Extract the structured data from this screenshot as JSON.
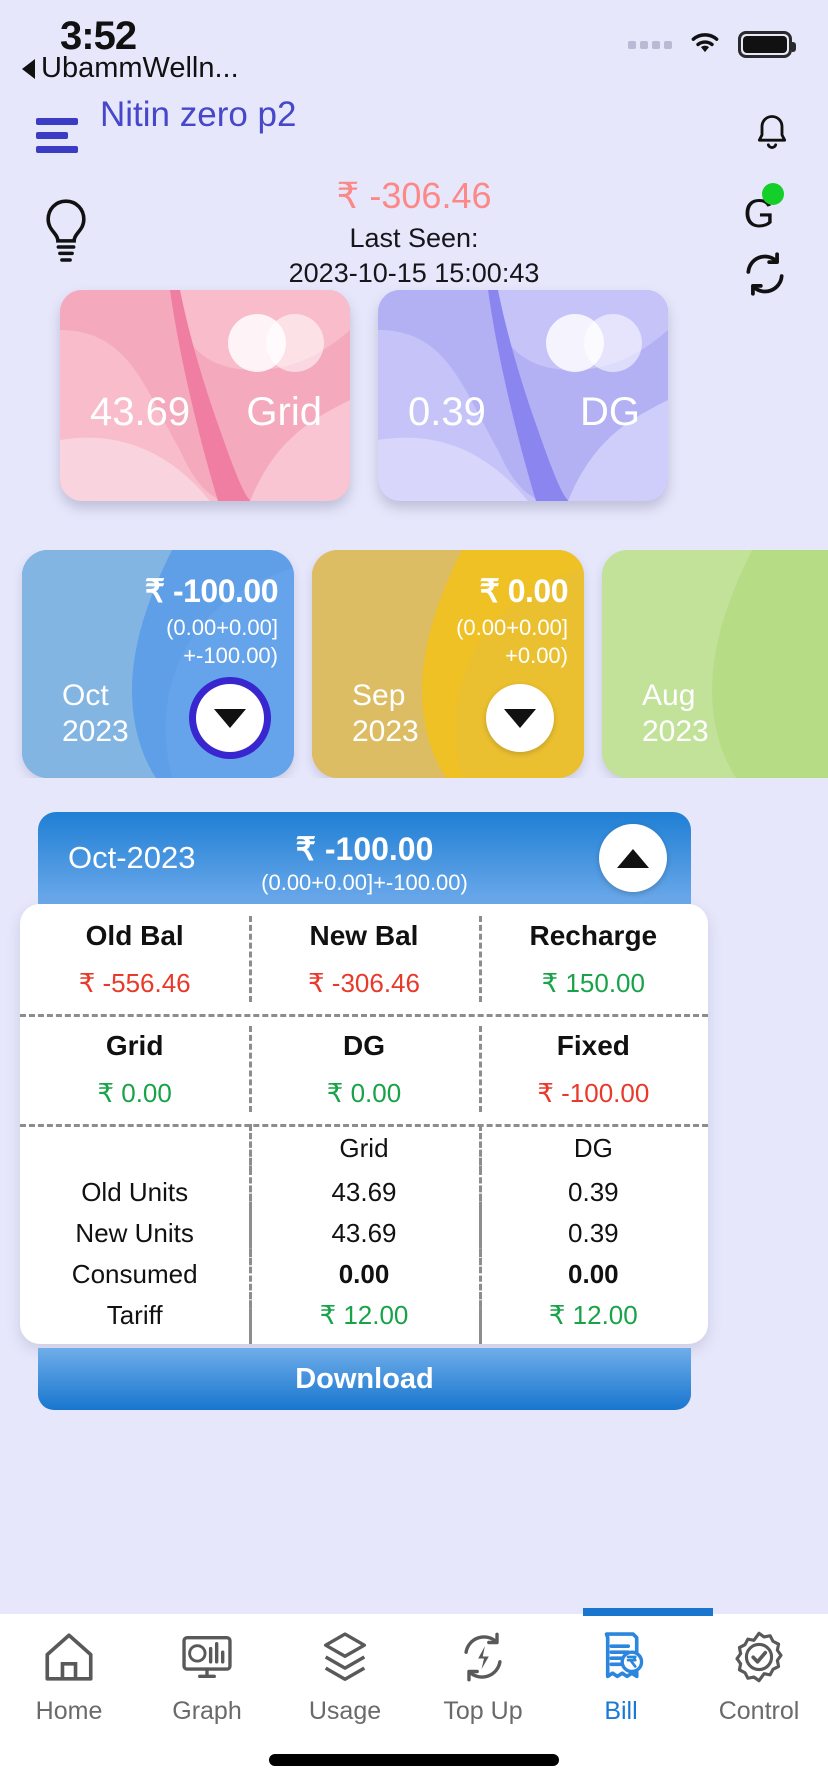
{
  "status_bar": {
    "time": "3:52",
    "back_label": "UbammWelln...",
    "wifi_icon": "wifi-icon",
    "battery_icon": "battery-icon",
    "signal_icon": "signal-dots-icon"
  },
  "header": {
    "menu_icon": "hamburger-icon",
    "title": "Nitin zero p2",
    "bell_icon": "bell-icon"
  },
  "balance": {
    "bulb_icon": "bulb-icon",
    "amount": "₹ -306.46",
    "amount_color": "#fd8888",
    "last_seen_label": "Last Seen:",
    "last_seen_value": "2023-10-15 15:00:43",
    "gateway_letter": "G",
    "gateway_status_color": "#14cf2a",
    "refresh_icon": "refresh-icon"
  },
  "meters": [
    {
      "value": "43.69",
      "label": "Grid",
      "color": "#f5a6bb"
    },
    {
      "value": "0.39",
      "label": "DG",
      "color": "#b0b0f2"
    }
  ],
  "months": [
    {
      "amount": "₹ -100.00",
      "breakdown_line1": "(0.00+0.00]",
      "breakdown_line2": "+-100.00)",
      "month": "Oct",
      "year": "2023",
      "color": "#5e9fe8",
      "expanded": true,
      "toggle_icon": "chevron-down-icon"
    },
    {
      "amount": "₹ 0.00",
      "breakdown_line1": "(0.00+0.00]",
      "breakdown_line2": "+0.00)",
      "month": "Sep",
      "year": "2023",
      "color": "#efc124",
      "expanded": false,
      "toggle_icon": "chevron-down-icon"
    },
    {
      "amount": "",
      "breakdown_line1": "",
      "breakdown_line2": "",
      "month": "Aug",
      "year": "2023",
      "color": "#b6dd86",
      "expanded": false,
      "toggle_icon": "chevron-down-icon"
    }
  ],
  "bill": {
    "header_month": "Oct-2023",
    "header_amount": "₹ -100.00",
    "header_breakdown": "(0.00+0.00]+-100.00)",
    "collapse_icon": "chevron-up-icon",
    "summary_row_1": [
      {
        "label": "Old Bal",
        "value": "₹ -556.46",
        "tone": "neg"
      },
      {
        "label": "New Bal",
        "value": "₹ -306.46",
        "tone": "neg"
      },
      {
        "label": "Recharge",
        "value": "₹ 150.00",
        "tone": "pos"
      }
    ],
    "summary_row_2": [
      {
        "label": "Grid",
        "value": "₹ 0.00",
        "tone": "pos"
      },
      {
        "label": "DG",
        "value": "₹ 0.00",
        "tone": "pos"
      },
      {
        "label": "Fixed",
        "value": "₹ -100.00",
        "tone": "neg"
      }
    ],
    "units_header": [
      "",
      "Grid",
      "DG"
    ],
    "units_rows": [
      {
        "label": "Old Units",
        "grid": "43.69",
        "dg": "0.39",
        "bold": false,
        "green": false
      },
      {
        "label": "New Units",
        "grid": "43.69",
        "dg": "0.39",
        "bold": false,
        "green": false
      },
      {
        "label": "Consumed",
        "grid": "0.00",
        "dg": "0.00",
        "bold": true,
        "green": false
      },
      {
        "label": "Tariff",
        "grid": "₹ 12.00",
        "dg": "₹ 12.00",
        "bold": false,
        "green": true
      }
    ],
    "download_label": "Download"
  },
  "tabs": [
    {
      "label": "Home",
      "icon": "home-icon",
      "active": false
    },
    {
      "label": "Graph",
      "icon": "monitor-chart-icon",
      "active": false
    },
    {
      "label": "Usage",
      "icon": "layers-icon",
      "active": false
    },
    {
      "label": "Top Up",
      "icon": "refresh-bolt-icon",
      "active": false
    },
    {
      "label": "Bill",
      "icon": "receipt-icon",
      "active": true
    },
    {
      "label": "Control",
      "icon": "gear-check-icon",
      "active": false
    }
  ],
  "theme": {
    "background": "#e6e7fb",
    "accent": "#1876cf",
    "title_color": "#4747c9"
  }
}
